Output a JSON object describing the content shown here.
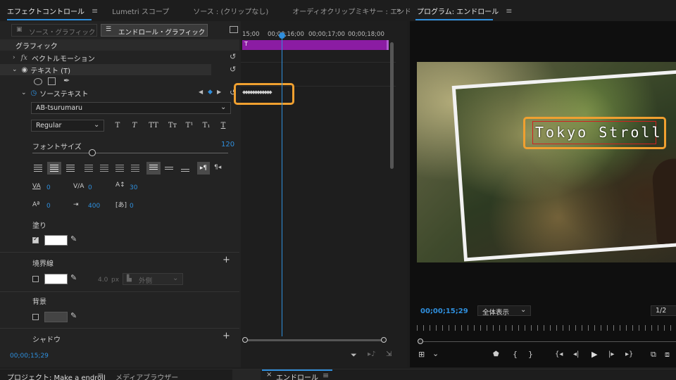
{
  "effect_controls": {
    "tabs": [
      "エフェクトコントロール",
      "Lumetri スコープ",
      "ソース : (クリップなし)",
      "オーディオクリップミキサー : エンドロ…"
    ],
    "subtabs": [
      "ソース・グラフィック",
      "エンドロール・グラフィック"
    ],
    "timeline_times": [
      "15;00",
      "00;00;16;00",
      "00;00;17;00",
      "00;00;18;00"
    ],
    "clip_label": "T",
    "section_graphic": "グラフィック",
    "vector_motion": "ベクトルモーション",
    "text_layer": "テキスト (T)",
    "source_text": "ソーステキスト",
    "font_name": "AB-tsurumaru",
    "font_style": "Regular",
    "type_buttons": [
      "T",
      "T",
      "TT",
      "Tт",
      "T¹",
      "T₁",
      "T"
    ],
    "font_size_label": "フォントサイズ",
    "font_size_value": "120",
    "metrics": {
      "kerning": "0",
      "tracking": "0",
      "leading": "30",
      "baseline": "0",
      "tab_width": "400",
      "tsume": "0"
    },
    "fill_label": "塗り",
    "stroke_label": "境界線",
    "stroke_width": "4.0",
    "stroke_unit": "px",
    "stroke_position": "外側",
    "background_label": "背景",
    "shadow_label": "シャドウ",
    "current_time": "00;00;15;29",
    "fill_color": "#ffffff",
    "accent_color": "#2f8fdd"
  },
  "program": {
    "title": "プログラム: エンドロール",
    "timecode": "00;00;15;29",
    "zoom": "全体表示",
    "resolution": "1/2",
    "overlay_text": "Tokyo Stroll"
  },
  "bottom": {
    "project_tab": "プロジェクト: Make a endroll",
    "media_tab": "メディアブラウザー",
    "sequence_tab": "エンドロール"
  },
  "highlight_color": "#f0a030"
}
